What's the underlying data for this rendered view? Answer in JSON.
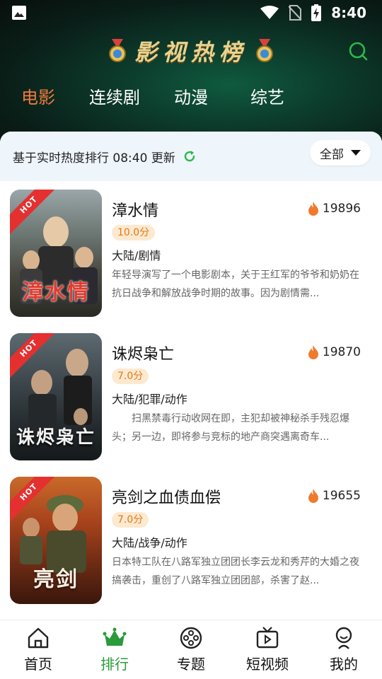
{
  "status_bar": {
    "time": "8:40"
  },
  "header": {
    "title": "影视热榜",
    "tabs": [
      {
        "label": "电影",
        "active": true
      },
      {
        "label": "连续剧",
        "active": false
      },
      {
        "label": "动漫",
        "active": false
      },
      {
        "label": "综艺",
        "active": false
      }
    ]
  },
  "info_bar": {
    "text": "基于实时热度排行 08:40 更新",
    "filter_label": "全部"
  },
  "items": [
    {
      "badge": "HOT",
      "title": "漳水情",
      "poster_title": "漳水情",
      "heat": "19896",
      "score": "10.0分",
      "genre": "大陆/剧情",
      "desc": "年轻导演写了一个电影剧本，关于王红军的爷爷和奶奶在抗日战争和解放战争时期的故事。因为剧情需..."
    },
    {
      "badge": "HOT",
      "title": "诛烬枭亡",
      "poster_title": "诛烬枭亡",
      "heat": "19870",
      "score": "7.0分",
      "genre": "大陆/犯罪/动作",
      "desc": "　　扫黑禁毒行动收网在即，主犯却被神秘杀手残忍爆头；另一边，即将参与竞标的地产商突遇离奇车..."
    },
    {
      "badge": "HOT",
      "title": "亮剑之血债血偿",
      "poster_title": "亮剑",
      "heat": "19655",
      "score": "7.0分",
      "genre": "大陆/战争/动作",
      "desc": "日本特工队在八路军独立团团长李云龙和秀芹的大婚之夜搞袭击，重创了八路军独立团团部，杀害了赵..."
    }
  ],
  "bottom_nav": [
    {
      "label": "首页",
      "icon": "home-icon",
      "active": false
    },
    {
      "label": "排行",
      "icon": "crown-icon",
      "active": true
    },
    {
      "label": "专题",
      "icon": "film-reel-icon",
      "active": false
    },
    {
      "label": "短视频",
      "icon": "tv-play-icon",
      "active": false
    },
    {
      "label": "我的",
      "icon": "user-icon",
      "active": false
    }
  ],
  "colors": {
    "accent_green": "#2a9a3a",
    "active_tab": "#f07a3c",
    "score_text": "#e07a1a",
    "hot_ribbon": "#e53030"
  }
}
